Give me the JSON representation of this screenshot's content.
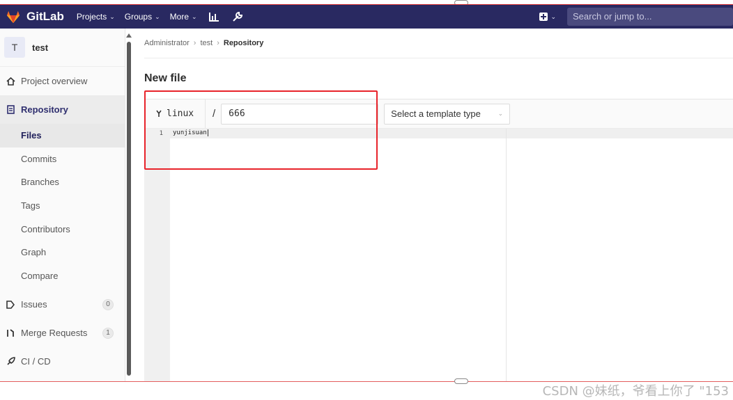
{
  "navbar": {
    "brand": "GitLab",
    "items": [
      {
        "label": "Projects"
      },
      {
        "label": "Groups"
      },
      {
        "label": "More"
      }
    ],
    "search_placeholder": "Search or jump to...",
    "bg_color": "#292961"
  },
  "sidebar": {
    "project_initial": "T",
    "project_name": "test",
    "overview": "Project overview",
    "repository": "Repository",
    "repo_items": [
      "Files",
      "Commits",
      "Branches",
      "Tags",
      "Contributors",
      "Graph",
      "Compare"
    ],
    "issues": {
      "label": "Issues",
      "count": "0"
    },
    "merge_requests": {
      "label": "Merge Requests",
      "count": "1"
    },
    "cicd": "CI / CD"
  },
  "breadcrumb": [
    "Administrator",
    "test",
    "Repository"
  ],
  "page_title": "New file",
  "file_form": {
    "branch": "linux",
    "separator": "/",
    "file_name": "666",
    "template_placeholder": "Select a template type"
  },
  "editor": {
    "line_number": "1",
    "line_content": "yunjisuan"
  },
  "watermark": "CSDN @妹纸，爷看上你了 \"153",
  "colors": {
    "highlight": "#e8232a",
    "accent": "#292961"
  }
}
